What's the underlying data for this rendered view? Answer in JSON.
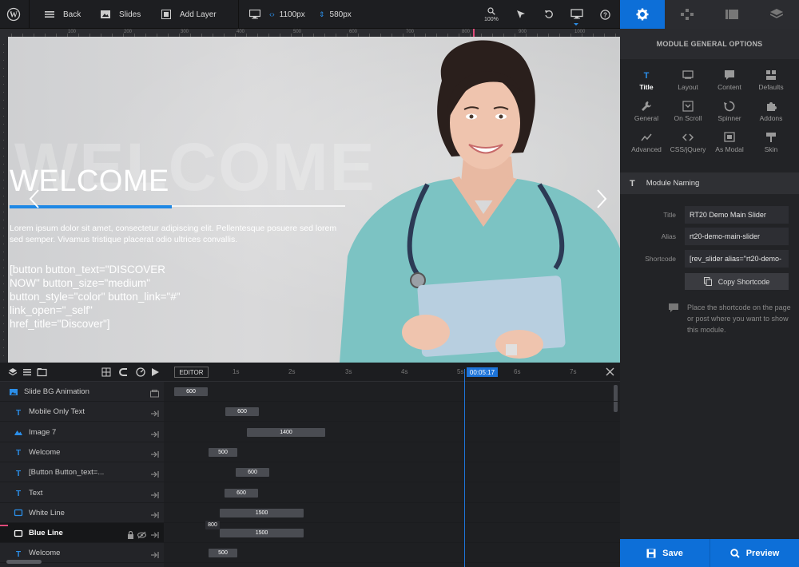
{
  "toolbar": {
    "back_label": "Back",
    "slides_label": "Slides",
    "add_layer_label": "Add Layer",
    "width_value": "1100px",
    "height_value": "580px",
    "zoom_value": "100%"
  },
  "ruler": {
    "labels": [
      "100",
      "200",
      "300",
      "400",
      "500",
      "600",
      "700",
      "800",
      "900",
      "1000"
    ]
  },
  "slide": {
    "bg_text": "WELCOME",
    "title": "WELCOME",
    "lorem": "Lorem ipsum dolor sit amet, consectetur adipiscing elit. Pellentesque posuere sed lorem sed semper. Vivamus tristique placerat odio ultrices convallis.",
    "button_code": "[button button_text=\"DISCOVER NOW\" button_size=\"medium\" button_style=\"color\" button_link=\"#\" link_open=\"_self\" href_title=\"Discover\"]"
  },
  "panel": {
    "header": "MODULE GENERAL OPTIONS",
    "options": [
      {
        "label": "Title",
        "icon": "title-icon"
      },
      {
        "label": "Layout",
        "icon": "layout-icon"
      },
      {
        "label": "Content",
        "icon": "content-icon"
      },
      {
        "label": "Defaults",
        "icon": "defaults-icon"
      },
      {
        "label": "General",
        "icon": "wrench-icon"
      },
      {
        "label": "On Scroll",
        "icon": "on-scroll-icon"
      },
      {
        "label": "Spinner",
        "icon": "spinner-icon"
      },
      {
        "label": "Addons",
        "icon": "puzzle-icon"
      },
      {
        "label": "Advanced",
        "icon": "advanced-icon"
      },
      {
        "label": "CSS/jQuery",
        "icon": "code-icon"
      },
      {
        "label": "As Modal",
        "icon": "modal-icon"
      },
      {
        "label": "Skin",
        "icon": "skin-icon"
      }
    ],
    "section_title": "Module Naming",
    "title_label": "Title",
    "title_value": "RT20 Demo Main Slider",
    "alias_label": "Alias",
    "alias_value": "rt20-demo-main-slider",
    "shortcode_label": "Shortcode",
    "shortcode_value": "[rev_slider alias=\"rt20-demo-",
    "copy_label": "Copy Shortcode",
    "hint": "Place the shortcode on the page or post where you want to show this module.",
    "save_label": "Save",
    "preview_label": "Preview"
  },
  "timeline": {
    "editor_label": "EDITOR",
    "current_time": "00:05:17",
    "time_marks": [
      "1s",
      "2s",
      "3s",
      "4s",
      "5s",
      "6s",
      "7s"
    ],
    "layers": [
      {
        "name": "Slide BG Animation",
        "icon": "image-icon",
        "bar": "600"
      },
      {
        "name": "Mobile Only Text",
        "icon": "text-icon",
        "bar": "600"
      },
      {
        "name": "Image 7",
        "icon": "image-layer-icon",
        "bar": "1400"
      },
      {
        "name": "Welcome",
        "icon": "text-icon",
        "bar": "500"
      },
      {
        "name": "[Button Button_text=...",
        "icon": "text-icon",
        "bar": "600"
      },
      {
        "name": "Text",
        "icon": "text-icon",
        "bar": "600"
      },
      {
        "name": "White Line",
        "icon": "shape-icon",
        "bar": "1500"
      },
      {
        "name": "Blue Line",
        "icon": "shape-icon",
        "bar": "1500",
        "extra": "800"
      },
      {
        "name": "Welcome",
        "icon": "text-icon",
        "bar": "500"
      }
    ]
  },
  "colors": {
    "accent": "#0d6fd8",
    "panel_bg": "#222326",
    "timeline_bg": "#1e1f22"
  }
}
